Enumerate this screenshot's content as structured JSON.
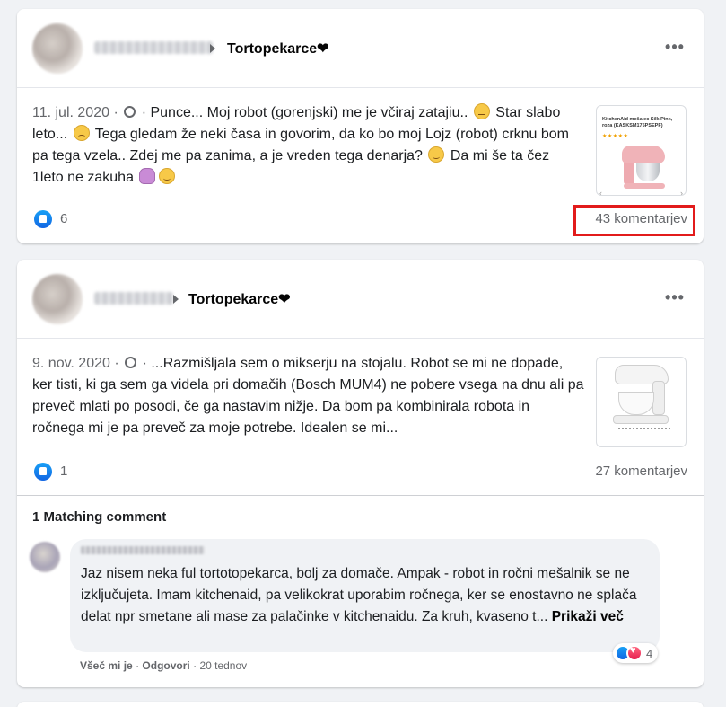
{
  "posts": [
    {
      "group": "Tortopekarce❤",
      "date": "11. jul. 2020",
      "separator": "·",
      "text": "Punce... Moj robot (gorenjski) me je včiraj zatajiu..",
      "text2": "Star slabo leto...",
      "text3": "Tega gledam že neki časa in govorim, da ko bo moj Lojz (robot) crknu bom pa tega vzela.. Zdej me pa zanima, a je vreden tega denarja?",
      "text4": "Da mi še ta čez 1leto ne zakuha",
      "thumb_title": "KitchenAid mešalec Silk Pink, roza (KASKSM175PSEPF)",
      "thumb_stars": "★★★★★",
      "likes": "6",
      "comments": "43 komentarjev"
    },
    {
      "group": "Tortopekarce❤",
      "date": "9. nov. 2020",
      "separator": "·",
      "text": "...Razmišljala sem o mikserju na stojalu. Robot se mi ne dopade, ker tisti, ki ga sem ga videla pri domačih (Bosch MUM4) ne pobere vsega na dnu ali pa preveč mlati po posodi, če ga nastavim nižje. Da bom pa kombinirala robota in ročnega mi je pa preveč za moje potrebe. Idealen se mi...",
      "likes": "1",
      "comments": "27 komentarjev",
      "matching_label": "1 Matching comment",
      "comment": {
        "text": "Jaz nisem neka ful tortotopekarca, bolj za domače. Ampak - robot in ročni mešalnik se ne izključujeta. Imam kitchenaid, pa velikokrat uporabim ročnega, ker se enostavno ne splača delat npr smetane ali mase za palačinke v kitchenaidu. Za kruh, kvaseno t...",
        "see_more": "Prikaži več",
        "reaction_count": "4",
        "like_action": "Všeč mi je",
        "reply_action": "Odgovori",
        "time": "20 tednov",
        "dot": "·"
      }
    }
  ],
  "more_icon_glyph": "•••"
}
